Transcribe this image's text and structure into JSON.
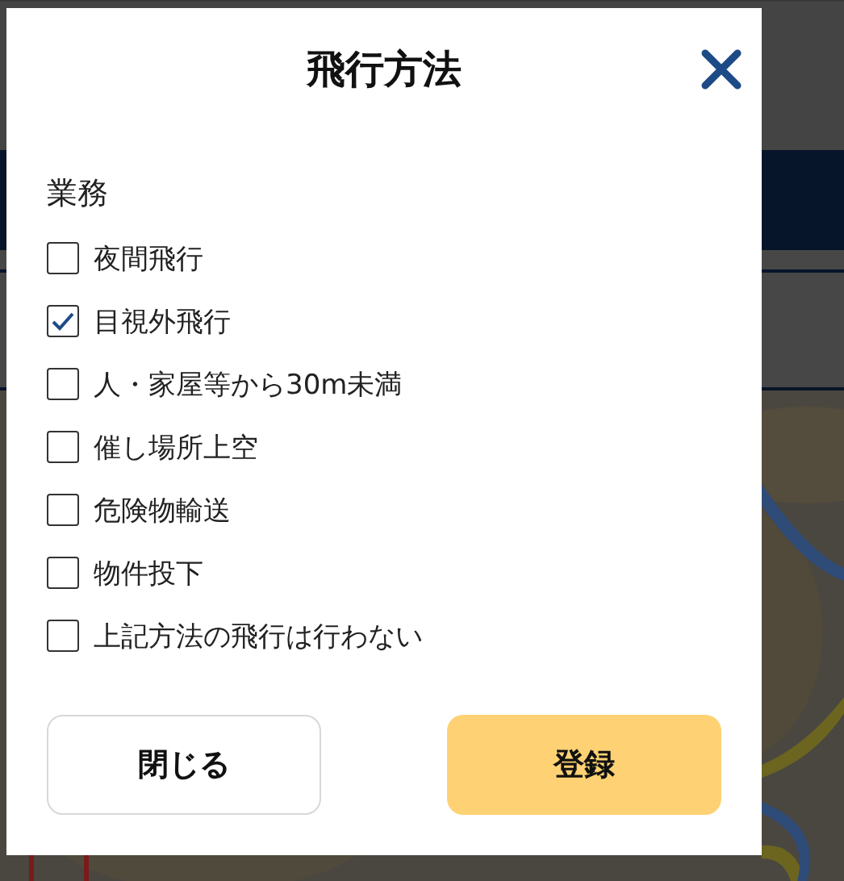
{
  "dialog": {
    "title": "飛行方法",
    "section_label": "業務",
    "options": [
      {
        "label": "夜間飛行",
        "checked": false
      },
      {
        "label": "目視外飛行",
        "checked": true
      },
      {
        "label": "人・家屋等から30m未満",
        "checked": false
      },
      {
        "label": "催し場所上空",
        "checked": false
      },
      {
        "label": "危険物輸送",
        "checked": false
      },
      {
        "label": "物件投下",
        "checked": false
      },
      {
        "label": "上記方法の飛行は行わない",
        "checked": false
      }
    ],
    "buttons": [
      {
        "label": "閉じる",
        "kind": "secondary"
      },
      {
        "label": "登録",
        "kind": "primary"
      }
    ]
  }
}
